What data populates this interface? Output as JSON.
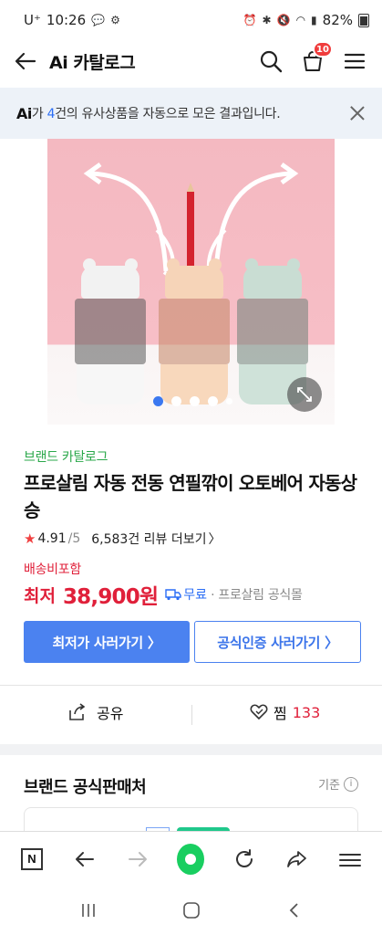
{
  "status_bar": {
    "carrier": "U⁺",
    "time": "10:26",
    "battery": "82%"
  },
  "header": {
    "title": "Ai 카탈로그",
    "cart_count": "10"
  },
  "ai_banner": {
    "mark": "Ai",
    "prefix": "가 ",
    "count": "4",
    "suffix": "건의 유사상품을 자동으로 모은 결과입니다."
  },
  "product": {
    "brand_catalog": "브랜드 카탈로그",
    "title": "프로살림 자동 전동 연필깎이 오토베어 자동상승",
    "rating": "4.91",
    "rating_max": "/5",
    "reviews": "6,583건 리뷰 더보기",
    "shipping_included": "배송비포함",
    "price_label": "최저",
    "price": "38,900원",
    "free_shipping": "무료",
    "seller": "· 프로살림 공식몰",
    "image_dots": 5,
    "image_index": 1
  },
  "buttons": {
    "lowest": "최저가 사러가기 〉",
    "official": "공식인증 사러가기 〉"
  },
  "actions": {
    "share": "공유",
    "zzim": "찜",
    "zzim_count": "133"
  },
  "section": {
    "title": "브랜드 공식판매처",
    "criteria": "기준"
  },
  "colors": {
    "accent_blue": "#4b82f0",
    "price_red": "#e0203a",
    "brand_green": "#2aa84a",
    "naver_green": "#19ce60"
  },
  "icons": [
    "back-arrow-icon",
    "search-icon",
    "cart-icon",
    "menu-icon",
    "close-icon",
    "expand-icon",
    "share-icon",
    "heart-icon",
    "info-icon",
    "naver-n-icon",
    "browser-back-icon",
    "browser-forward-icon",
    "naver-home-icon",
    "refresh-icon",
    "browser-share-icon",
    "browser-menu-icon",
    "recent-apps-icon",
    "home-icon",
    "nav-back-icon"
  ]
}
